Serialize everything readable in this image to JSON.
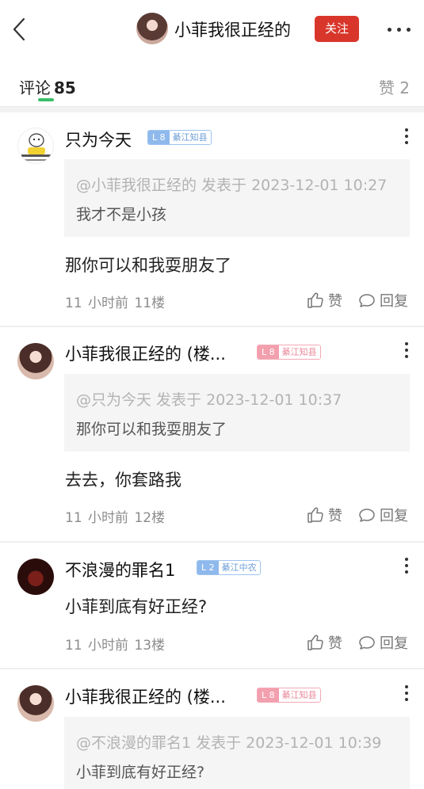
{
  "header": {
    "back_icon": "chevron-left-icon",
    "user_name": "小菲我很正经的",
    "follow_label": "关注",
    "more_icon": "more-horizontal-icon",
    "accent": "#d9362b"
  },
  "tabs": {
    "comments_label": "评论",
    "comments_count": "85",
    "likes_label": "赞 2",
    "active_color": "#3bbf6a"
  },
  "comments": [
    {
      "user": "只为今天",
      "level": "L 8",
      "title": "綦江知县",
      "quote_meta": "@小菲我很正经的 发表于 2023-12-01 10:27",
      "quote_text": "我才不是小孩",
      "text": "那你可以和我耍朋友了",
      "meta": "11 小时前 11楼",
      "like_label": "赞",
      "reply_label": "回复"
    },
    {
      "user": "小菲我很正经的 (楼...",
      "level": "L 8",
      "title": "綦江知县",
      "quote_meta": "@只为今天 发表于 2023-12-01 10:37",
      "quote_text": "那你可以和我耍朋友了",
      "text": "去去，你套路我",
      "meta": "11 小时前 12楼",
      "like_label": "赞",
      "reply_label": "回复"
    },
    {
      "user": "不浪漫的罪名1",
      "level": "L 2",
      "title": "綦江中农",
      "text": "小菲到底有好正经?",
      "meta": "11 小时前 13楼",
      "like_label": "赞",
      "reply_label": "回复"
    },
    {
      "user": "小菲我很正经的 (楼...",
      "level": "L 8",
      "title": "綦江知县",
      "quote_meta": "@不浪漫的罪名1 发表于 2023-12-01 10:39",
      "quote_text": "小菲到底有好正经?"
    }
  ]
}
